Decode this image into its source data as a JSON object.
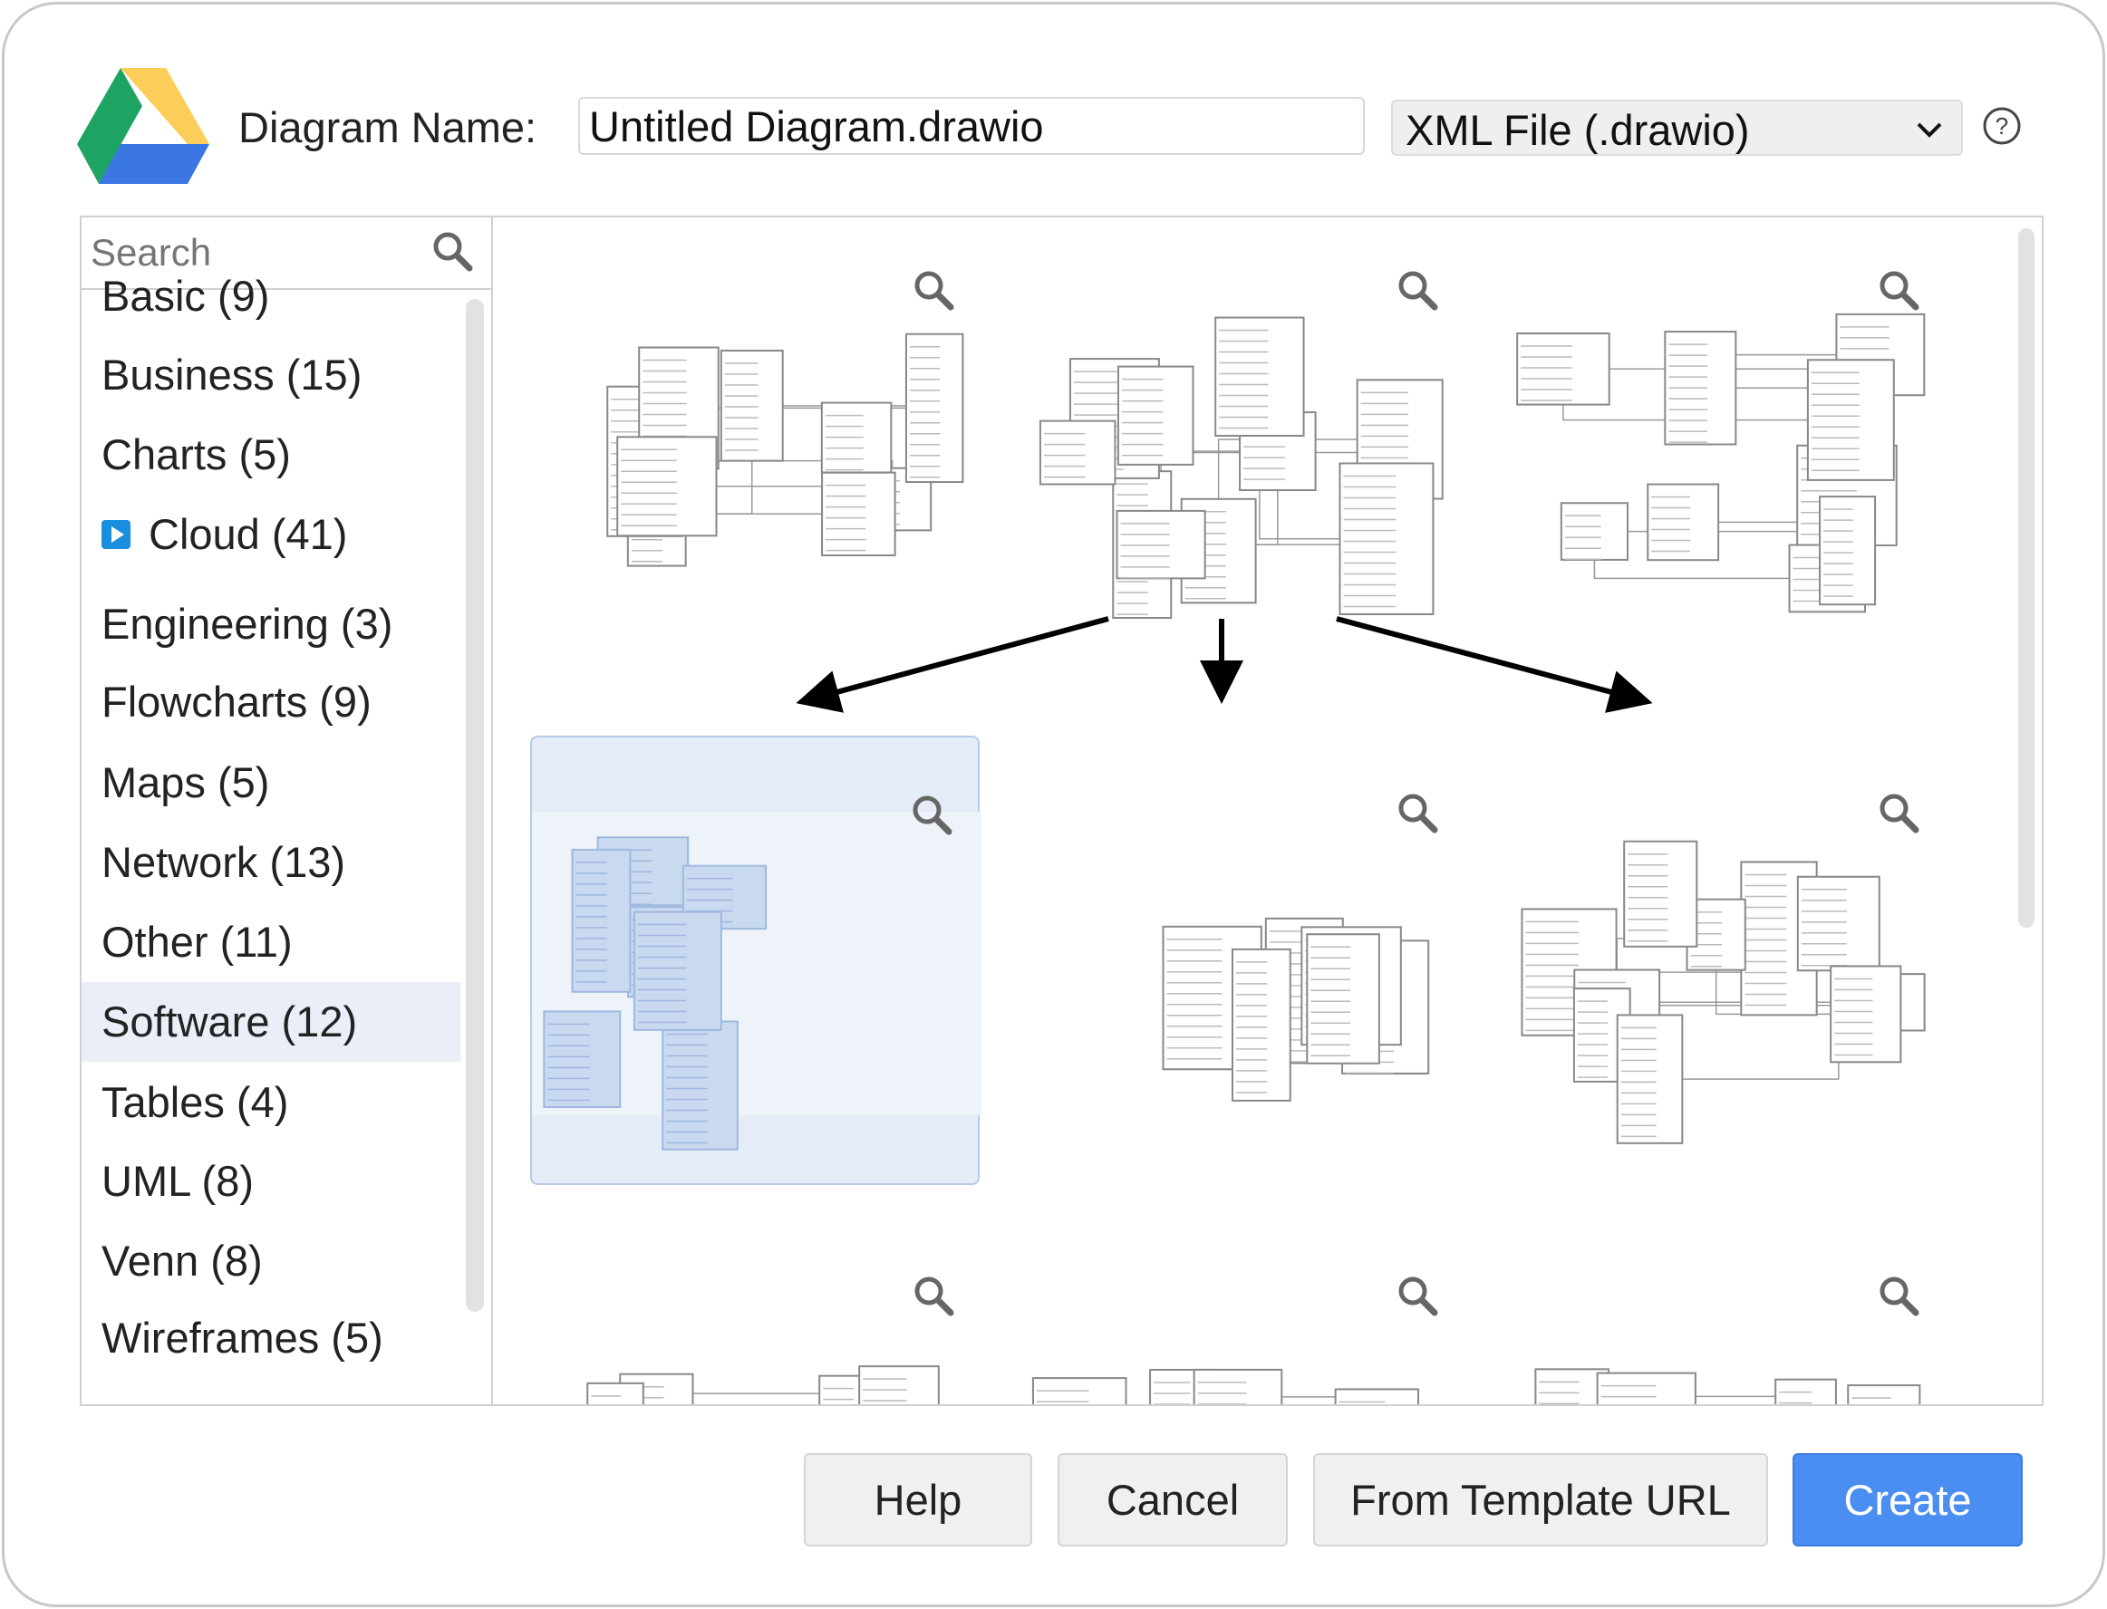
{
  "header": {
    "label": "Diagram Name:",
    "filename": "Untitled Diagram.drawio",
    "format": "XML File (.drawio)",
    "logo": "google-drive-logo",
    "help_icon": "help-circle-icon"
  },
  "sidebar": {
    "search_placeholder": "Search",
    "categories": [
      {
        "label": "Basic (9)"
      },
      {
        "label": "Business (15)"
      },
      {
        "label": "Charts (5)"
      },
      {
        "label": "Cloud (41)",
        "icon": "cloud-badge-icon"
      },
      {
        "label": "Engineering (3)"
      },
      {
        "label": "Flowcharts (9)"
      },
      {
        "label": "Maps (5)"
      },
      {
        "label": "Network (13)"
      },
      {
        "label": "Other (11)"
      },
      {
        "label": "Software (12)",
        "selected": true
      },
      {
        "label": "Tables (4)"
      },
      {
        "label": "UML (8)"
      },
      {
        "label": "Venn (8)"
      },
      {
        "label": "Wireframes (5)"
      }
    ]
  },
  "templates": {
    "selected_index": 3,
    "count_visible": 9
  },
  "buttons": {
    "help": "Help",
    "cancel": "Cancel",
    "from_url": "From Template URL",
    "create": "Create"
  },
  "colors": {
    "accent": "#4b8ef1",
    "selected_bg": "#e9eef7",
    "thumb_selected": "#e4ecf7"
  }
}
